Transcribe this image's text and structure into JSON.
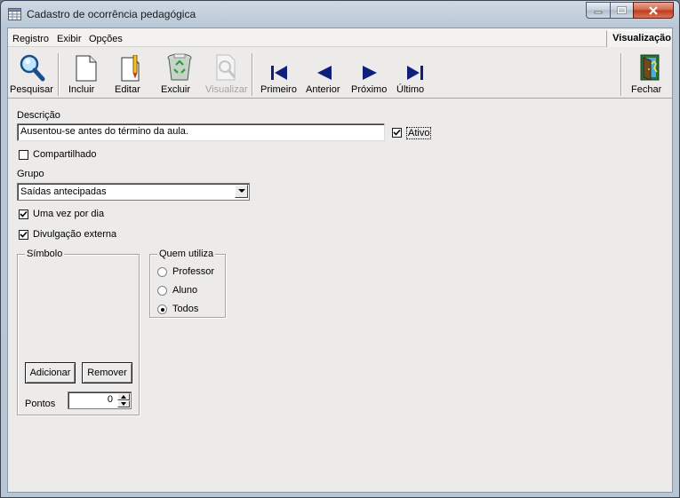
{
  "window": {
    "title": "Cadastro de ocorrência pedagógica"
  },
  "menu": {
    "items": [
      "Registro",
      "Exibir",
      "Opções"
    ],
    "mode_label": "Visualização"
  },
  "toolbar": {
    "pesquisar": "Pesquisar",
    "incluir": "Incluir",
    "editar": "Editar",
    "excluir": "Excluir",
    "visualizar": "Visualizar",
    "primeiro": "Primeiro",
    "anterior": "Anterior",
    "proximo": "Próximo",
    "ultimo": "Último",
    "fechar": "Fechar"
  },
  "form": {
    "descricao_label": "Descrição",
    "descricao_value": "Ausentou-se antes do término da aula.",
    "ativo_label": "Ativo",
    "ativo_checked": true,
    "compartilhado_label": "Compartilhado",
    "compartilhado_checked": false,
    "grupo_label": "Grupo",
    "grupo_value": "Saídas antecipadas",
    "uma_vez_label": "Uma vez por dia",
    "uma_vez_checked": true,
    "divulgacao_label": "Divulgação externa",
    "divulgacao_checked": true,
    "simbolo_title": "Símbolo",
    "adicionar": "Adicionar",
    "remover": "Remover",
    "pontos_label": "Pontos",
    "pontos_value": "0",
    "quem_title": "Quem utiliza",
    "quem_options": [
      "Professor",
      "Aluno",
      "Todos"
    ],
    "quem_selected": "Todos"
  }
}
